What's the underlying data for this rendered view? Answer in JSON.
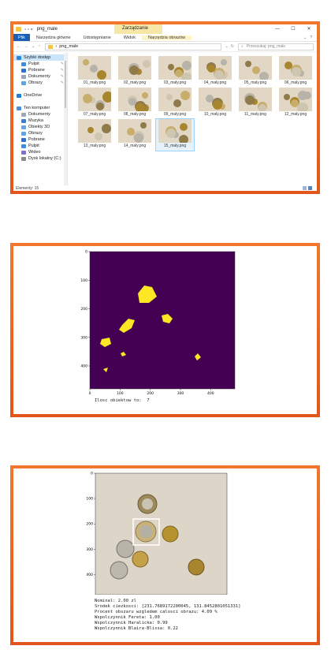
{
  "explorer": {
    "title": "png_male",
    "context_tab": "Zarządzanie",
    "window_controls": [
      "—",
      "☐",
      "✕"
    ],
    "ribbon_tabs": [
      {
        "label": "Plik",
        "style": "file"
      },
      {
        "label": "Narzędzia główne",
        "style": "normal"
      },
      {
        "label": "Udostępnianie",
        "style": "normal"
      },
      {
        "label": "Widok",
        "style": "normal"
      },
      {
        "label": "Narzędzia obrazów",
        "style": "yellow"
      }
    ],
    "breadcrumb": [
      "png_male"
    ],
    "search_placeholder": "Przeszukaj: png_male",
    "nav": [
      {
        "label": "Szybki dostęp",
        "icon": "star-icon",
        "color": "#2b88d8",
        "level": 0,
        "selected": true
      },
      {
        "label": "Pulpit",
        "icon": "desktop-icon",
        "color": "#3a8ee6",
        "level": 1,
        "pinned": true
      },
      {
        "label": "Pobrane",
        "icon": "download-icon",
        "color": "#2f6fd6",
        "level": 1,
        "pinned": true
      },
      {
        "label": "Dokumenty",
        "icon": "document-icon",
        "color": "#9aa7b8",
        "level": 1,
        "pinned": true
      },
      {
        "label": "Obrazy",
        "icon": "pictures-icon",
        "color": "#5da4e6",
        "level": 1,
        "pinned": true
      },
      {
        "label": "OneDrive",
        "icon": "cloud-icon",
        "color": "#1f7fd6",
        "level": 0,
        "gap": true
      },
      {
        "label": "Ten komputer",
        "icon": "computer-icon",
        "color": "#4a90d9",
        "level": 0,
        "gap": true
      },
      {
        "label": "Dokumenty",
        "icon": "document-icon",
        "color": "#9aa7b8",
        "level": 1
      },
      {
        "label": "Muzyka",
        "icon": "music-icon",
        "color": "#3b7fd1",
        "level": 1
      },
      {
        "label": "Obiekty 3D",
        "icon": "cube-icon",
        "color": "#6aa3e0",
        "level": 1
      },
      {
        "label": "Obrazy",
        "icon": "pictures-icon",
        "color": "#5da4e6",
        "level": 1
      },
      {
        "label": "Pobrane",
        "icon": "download-icon",
        "color": "#2f6fd6",
        "level": 1
      },
      {
        "label": "Pulpit",
        "icon": "desktop-icon",
        "color": "#3a8ee6",
        "level": 1
      },
      {
        "label": "Wideo",
        "icon": "video-icon",
        "color": "#7c6fd0",
        "level": 1
      },
      {
        "label": "Dysk lokalny (C:)",
        "icon": "drive-icon",
        "color": "#8a8a8a",
        "level": 1
      }
    ],
    "files": [
      "01_maly.png",
      "02_maly.png",
      "03_maly.png",
      "04_maly.png",
      "05_maly.png",
      "06_maly.png",
      "07_maly.png",
      "08_maly.png",
      "09_maly.png",
      "10_maly.png",
      "11_maly.png",
      "12_maly.png",
      "13_maly.png",
      "14_maly.png",
      "15_maly.png"
    ],
    "selected_file": "15_maly.png",
    "status": "Elementy: 15"
  },
  "segmentation": {
    "chart_data": {
      "type": "image",
      "colormap_background": "#440154",
      "object_color": "#fde725",
      "x_ticks": [
        0,
        100,
        200,
        300,
        400
      ],
      "y_ticks": [
        0,
        100,
        200,
        300,
        400
      ],
      "xlim": [
        0,
        480
      ],
      "ylim": [
        480,
        0
      ]
    },
    "caption": "Ilosc obiektow to:  7"
  },
  "coin_plot": {
    "chart_data": {
      "type": "image",
      "background": "#ddd6c8",
      "x_ticks": [
        0,
        100,
        200,
        300,
        400
      ],
      "y_ticks": [
        0,
        100,
        200,
        300,
        400
      ],
      "xlim": [
        0,
        480
      ],
      "ylim": [
        480,
        0
      ],
      "bbox_color": "#ffffff"
    },
    "results": [
      "Nominal: 2.00 zl",
      "Srodek ciezkosci: [231.7689172200045, 131.8452801051331]",
      "Procent obszaru wzgledem calosci obrazu: 4.09 %",
      "Wspolczynnik Fereta: 1.00",
      "Wspolczynnik Haralicka: 0.99",
      "Wspolczynnik Blaira-Blissa: 0.22"
    ]
  }
}
